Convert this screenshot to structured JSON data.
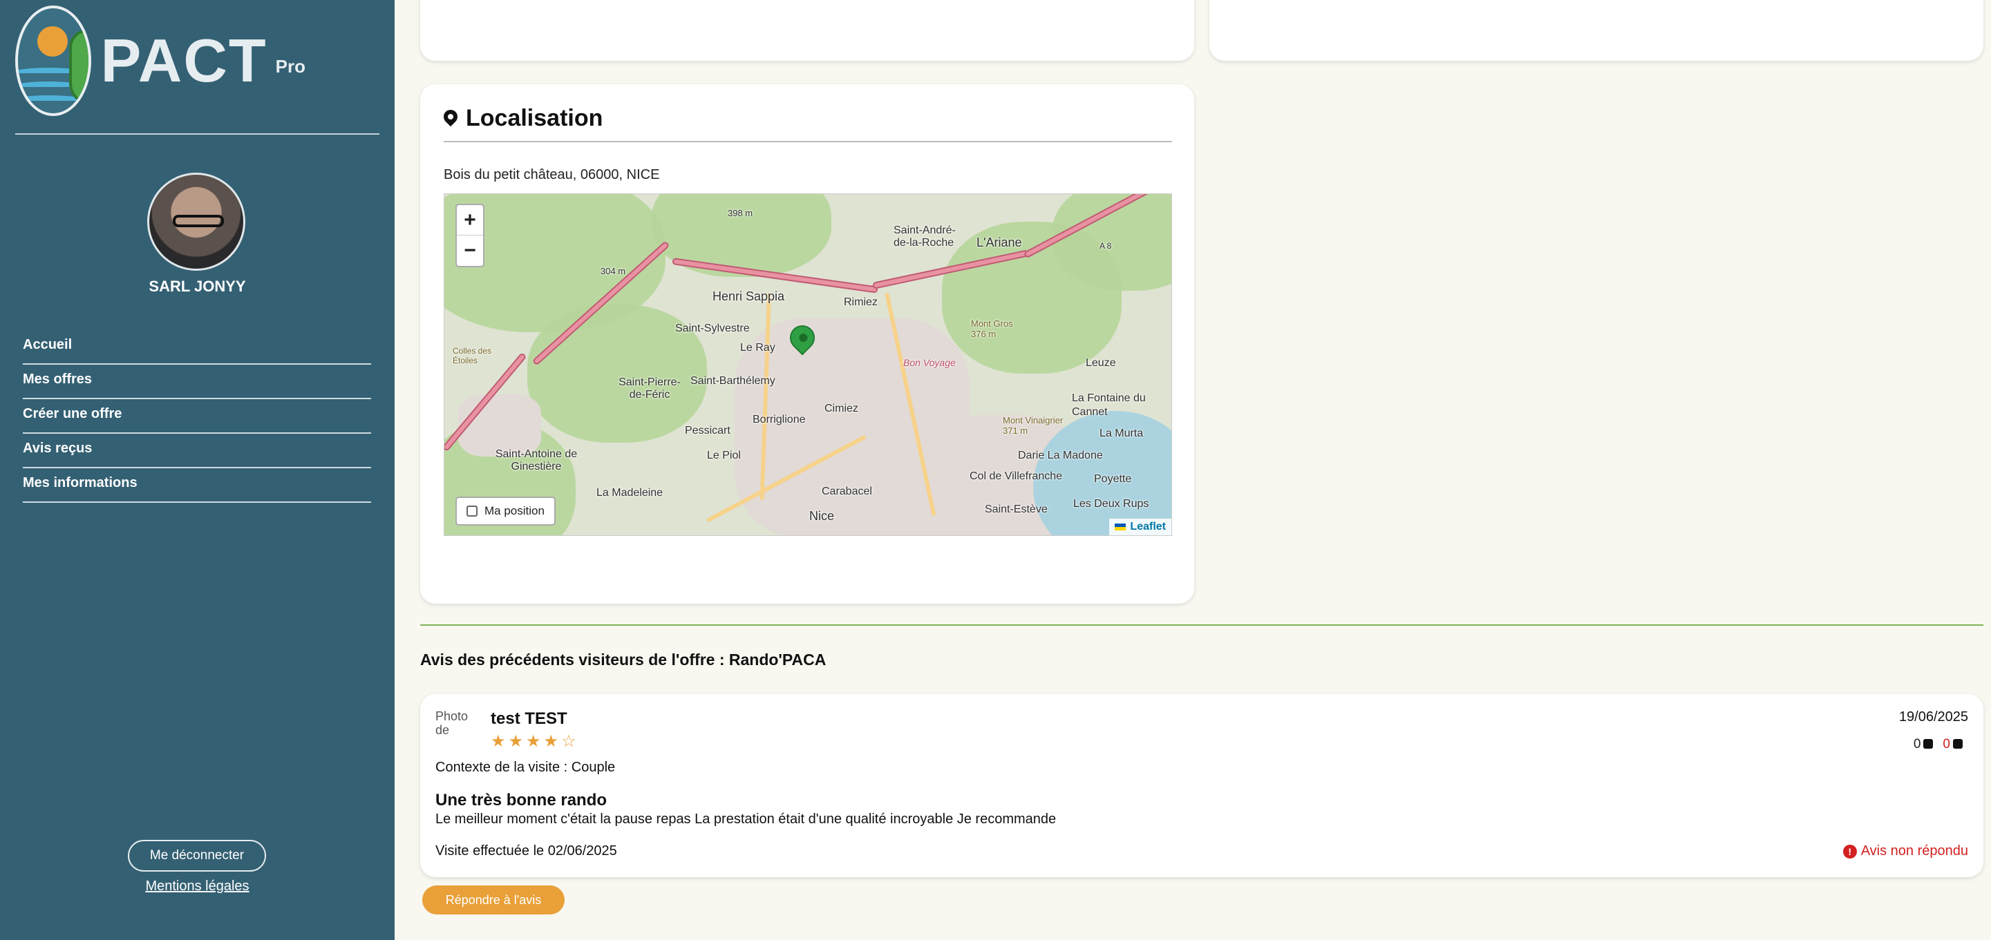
{
  "sidebar": {
    "logo_text": "PACT",
    "logo_badge": "Pro",
    "company_name": "SARL JONYY",
    "nav": [
      {
        "label": "Accueil"
      },
      {
        "label": "Mes offres"
      },
      {
        "label": "Créer une offre"
      },
      {
        "label": "Avis reçus"
      },
      {
        "label": "Mes informations"
      }
    ],
    "logout_label": "Me déconnecter",
    "legal_label": "Mentions légales"
  },
  "location": {
    "title": "Localisation",
    "address": "Bois du petit château, 06000, NICE",
    "map": {
      "zoom_in": "+",
      "zoom_out": "−",
      "my_position_label": "Ma position",
      "attribution": "Leaflet",
      "places": [
        "398 m",
        "Saint-André-de-la-Roche",
        "L'Ariane",
        "A 8",
        "304 m",
        "Henri Sappia",
        "Rimiez",
        "Saint-Sylvestre",
        "Le Ray",
        "Mont Gros 376 m",
        "Saint-Pierre-de-Féric",
        "Saint-Barthélemy",
        "Bon Voyage",
        "Leuze",
        "La Fontaine du Cannet",
        "Borriglione",
        "Cimiez",
        "Pessicart",
        "Mont Vinaigrier 371 m",
        "La Murta",
        "Le Piol",
        "Darie La Madone",
        "Saint-Antoine de Ginestière",
        "La Madeleine",
        "Carabacel",
        "Col de Villefranche",
        "Poyette",
        "Nice",
        "Saint-Estève",
        "Les Deux Rups",
        "Colles des Étoiles"
      ]
    }
  },
  "reviews": {
    "heading": "Avis des précédents visiteurs de l'offre : Rando'PACA",
    "items": [
      {
        "photo_alt": "Photo de",
        "author": "test TEST",
        "stars": "★★★★☆",
        "rating": 4,
        "date": "19/06/2025",
        "likes": "0",
        "dislikes": "0",
        "context": "Contexte de la visite : Couple",
        "title": "Une très bonne rando",
        "text": "Le meilleur moment c'était la pause repas La prestation était d'une qualité incroyable Je recommande",
        "visit": "Visite effectuée le 02/06/2025",
        "status": "Avis non répondu",
        "reply_label": "Répondre à l'avis"
      }
    ]
  }
}
